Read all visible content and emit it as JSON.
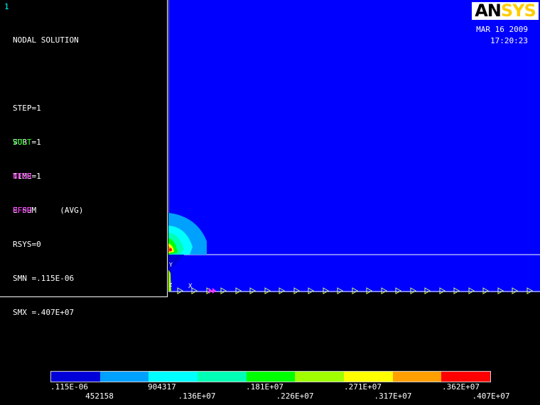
{
  "window_number": "1",
  "info": {
    "lines": [
      "NODAL SOLUTION",
      "",
      "STEP=1",
      "SUB =1",
      "TIME=1",
      "EFSUM     (AVG)",
      "RSYS=0",
      "SMN =.115E-06",
      "SMX =.407E+07"
    ]
  },
  "legend": {
    "items": [
      {
        "label": "VOLT",
        "color": "#33ff33"
      },
      {
        "label": "NFOR",
        "color": "#ff33ff"
      },
      {
        "label": "RFOR",
        "color": "#ff33ff"
      }
    ]
  },
  "logo": {
    "part1": "AN",
    "part2": "SYS"
  },
  "date": "MAR 16 2009",
  "time": "17:20:23",
  "colors": {
    "background": "#000000",
    "field": "#0000ff",
    "contour": [
      "#0000d8",
      "#00a0ff",
      "#00ffff",
      "#00ffb4",
      "#00ff00",
      "#a0ff00",
      "#ffff00",
      "#ffa000",
      "#ff0000"
    ]
  },
  "colorbar": {
    "top_labels": [
      ".115E-06",
      "904317",
      ".181E+07",
      ".271E+07",
      ".362E+07"
    ],
    "bottom_labels": [
      "452158",
      ".136E+07",
      ".226E+07",
      ".317E+07",
      ".407E+07"
    ]
  },
  "plot_markers": {
    "x_marker": "X",
    "y_marker": "Y",
    "z_marker": "Z"
  }
}
